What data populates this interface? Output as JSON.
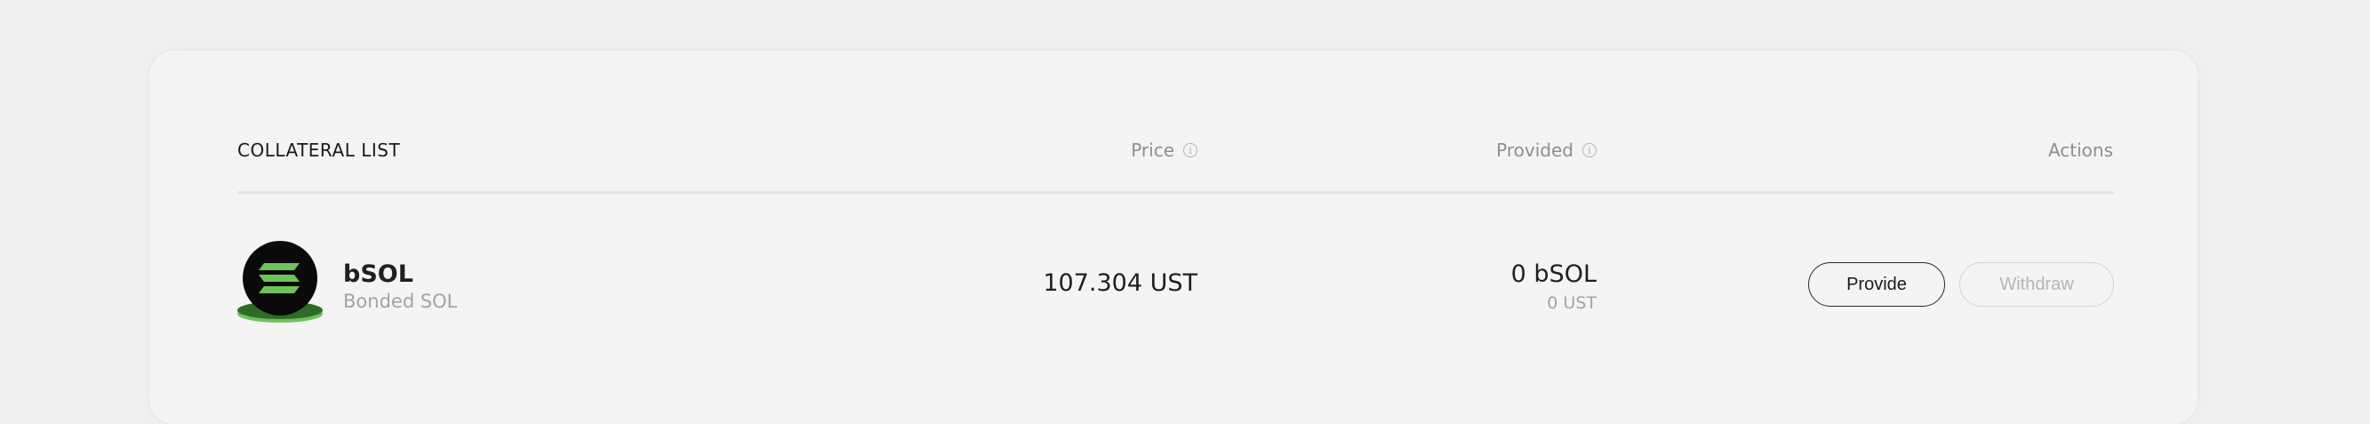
{
  "collateral_list": {
    "title": "COLLATERAL LIST",
    "columns": {
      "price": "Price",
      "provided": "Provided",
      "actions": "Actions"
    },
    "info_icon_glyph": "i",
    "rows": [
      {
        "icon": "solana-icon",
        "symbol": "bSOL",
        "name": "Bonded SOL",
        "price": "107.304 UST",
        "provided": "0 bSOL",
        "provided_value": "0 UST",
        "actions": {
          "provide": "Provide",
          "withdraw": "Withdraw"
        }
      }
    ]
  },
  "colors": {
    "page_background": "#efefef",
    "card_background": "#f4f4f4",
    "icon_green": "#6cc35a",
    "icon_dark_green": "#2f6b27",
    "text_primary": "#1f1f1f",
    "text_muted": "#a3a3a3",
    "button_disabled": "#b5b5b5"
  }
}
